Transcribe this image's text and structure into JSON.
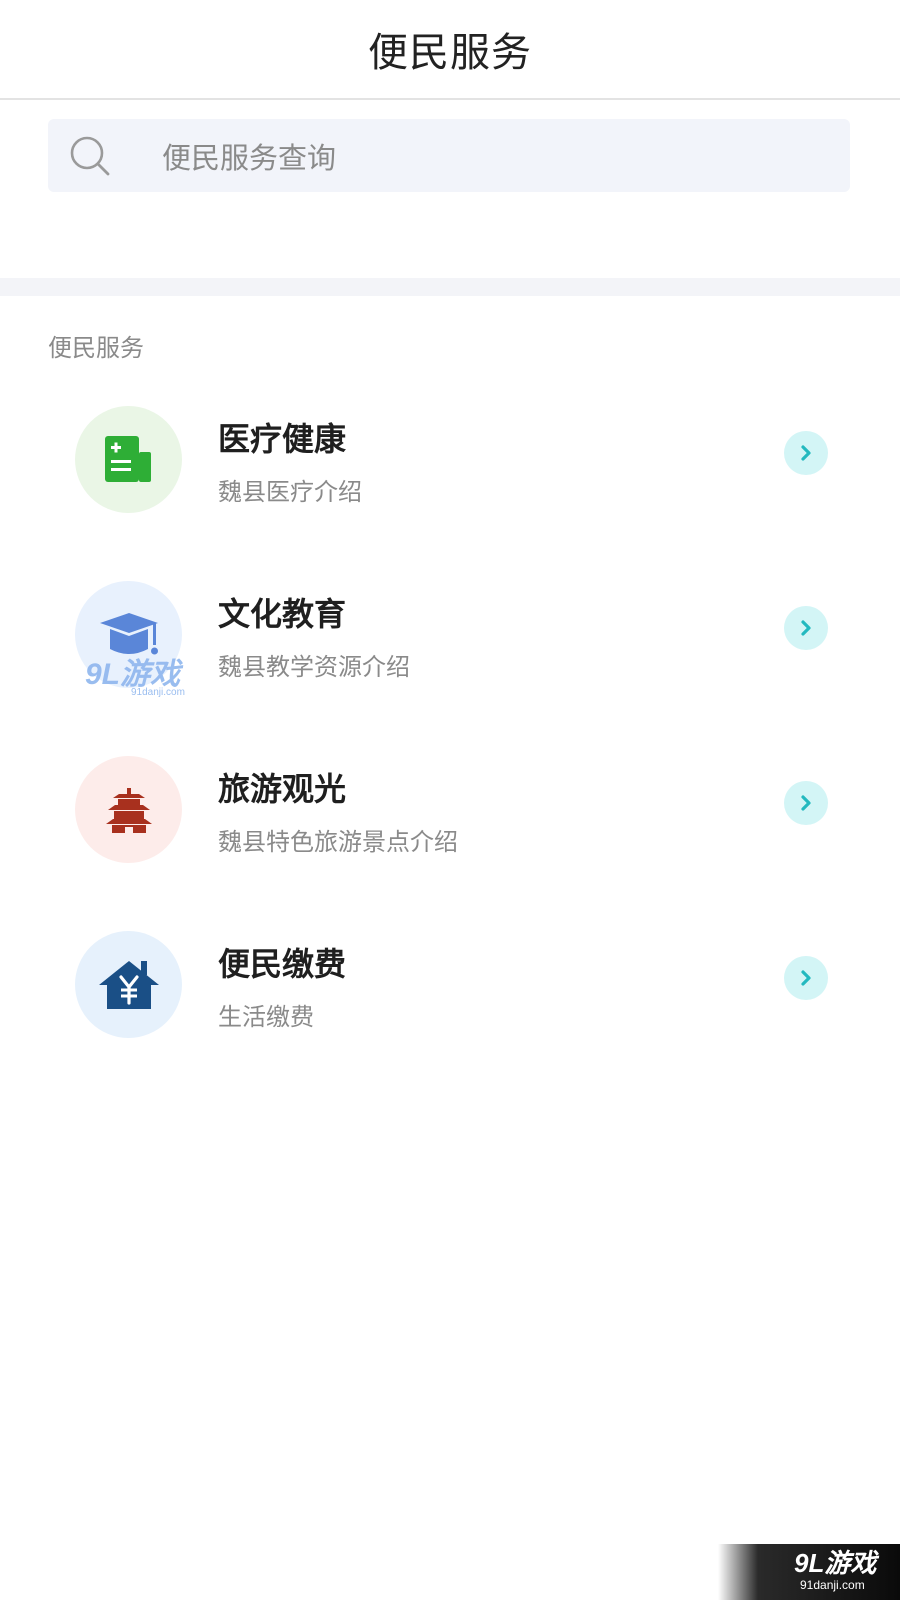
{
  "header": {
    "title": "便民服务"
  },
  "search": {
    "placeholder": "便民服务查询"
  },
  "section": {
    "title": "便民服务"
  },
  "services": [
    {
      "title": "医疗健康",
      "subtitle": "魏县医疗介绍",
      "icon": "medical-report-icon",
      "icon_bg": "#eaf6e6",
      "icon_color": "#2eae36"
    },
    {
      "title": "文化教育",
      "subtitle": "魏县教学资源介绍",
      "icon": "graduation-cap-icon",
      "icon_bg": "#e8f1fd",
      "icon_color": "#5a86d8"
    },
    {
      "title": "旅游观光",
      "subtitle": "魏县特色旅游景点介绍",
      "icon": "pagoda-icon",
      "icon_bg": "#fdecea",
      "icon_color": "#a8301e"
    },
    {
      "title": "便民缴费",
      "subtitle": "生活缴费",
      "icon": "house-yen-icon",
      "icon_bg": "#e6f1fc",
      "icon_color": "#1a4f86"
    }
  ],
  "colors": {
    "chevron_bg": "#d3f5f6",
    "chevron_fg": "#23b9bf",
    "search_bg": "#f2f4fa"
  },
  "watermark": {
    "main": "9L游戏",
    "sub": "91danji.com"
  }
}
